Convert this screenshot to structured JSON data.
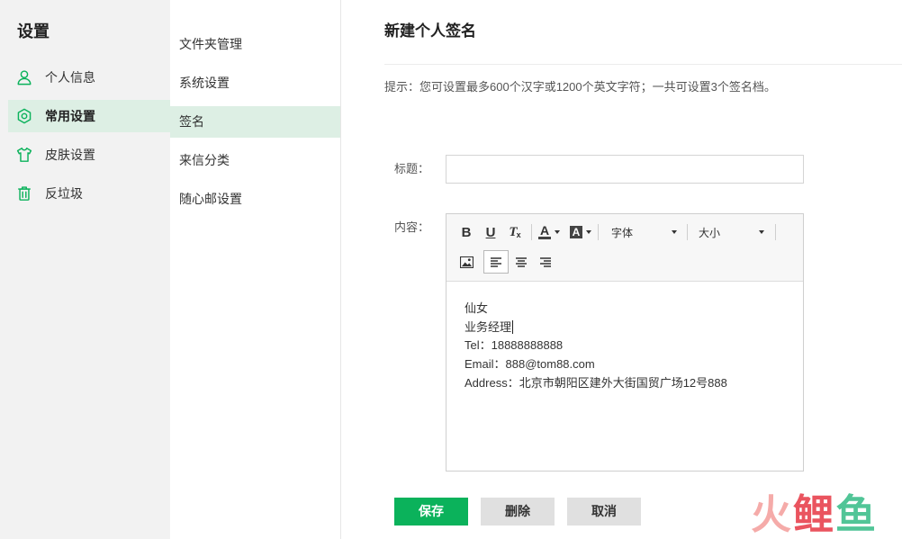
{
  "colors": {
    "accent": "#0bb25b",
    "active_bg": "#ddefe4",
    "sidebar_bg": "#f2f2f2",
    "button_gray": "#e0e0e0",
    "watermark": [
      "#f4a3a0",
      "#e8424e",
      "#3fbf8c"
    ]
  },
  "sidebar": {
    "title": "设置",
    "items": [
      {
        "label": "个人信息",
        "icon": "user-icon",
        "active": false
      },
      {
        "label": "常用设置",
        "icon": "gear-icon",
        "active": true
      },
      {
        "label": "皮肤设置",
        "icon": "shirt-icon",
        "active": false
      },
      {
        "label": "反垃圾",
        "icon": "trash-icon",
        "active": false
      }
    ]
  },
  "subnav": {
    "items": [
      {
        "label": "文件夹管理",
        "active": false
      },
      {
        "label": "系统设置",
        "active": false
      },
      {
        "label": "签名",
        "active": true
      },
      {
        "label": "来信分类",
        "active": false
      },
      {
        "label": "随心邮设置",
        "active": false
      }
    ]
  },
  "main": {
    "title": "新建个人签名",
    "hint": "提示：您可设置最多600个汉字或1200个英文字符；一共可设置3个签名档。",
    "form": {
      "title_label": "标题：",
      "title_value": "",
      "content_label": "内容："
    },
    "editor": {
      "toolbar": {
        "bold": "B",
        "underline": "U",
        "clear_format": "T",
        "clear_format_sub": "x",
        "font_color": "A",
        "background_color": "A",
        "font_family": "字体",
        "font_size": "大小",
        "icons": [
          "image-icon",
          "align-left-icon",
          "align-center-icon",
          "align-right-icon",
          "chevron-down-icon"
        ]
      },
      "alignment": "left",
      "content_lines": [
        "仙女",
        "业务经理",
        "Tel：18888888888",
        "Email：888@tom88.com",
        "Address：北京市朝阳区建外大街国贸广场12号888"
      ]
    },
    "buttons": {
      "save": "保存",
      "delete": "删除",
      "cancel": "取消"
    }
  },
  "watermark": {
    "chars": [
      "火",
      "鲤",
      "鱼"
    ]
  }
}
